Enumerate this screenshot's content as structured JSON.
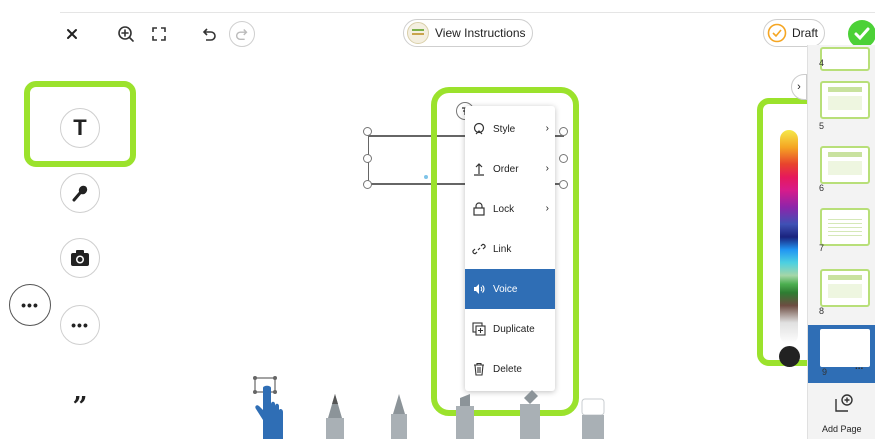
{
  "toolbar": {
    "view_instructions": "View Instructions",
    "draft": "Draft"
  },
  "context_menu": {
    "items": [
      {
        "label": "Style",
        "icon": "style-icon",
        "submenu": true
      },
      {
        "label": "Order",
        "icon": "order-icon",
        "submenu": true
      },
      {
        "label": "Lock",
        "icon": "lock-icon",
        "submenu": true
      },
      {
        "label": "Link",
        "icon": "link-icon",
        "submenu": false
      },
      {
        "label": "Voice",
        "icon": "speaker-icon",
        "submenu": false,
        "active": true
      },
      {
        "label": "Duplicate",
        "icon": "duplicate-icon",
        "submenu": false
      },
      {
        "label": "Delete",
        "icon": "trash-icon",
        "submenu": false
      }
    ]
  },
  "pages": {
    "numbers": [
      "4",
      "5",
      "6",
      "7",
      "8",
      "9"
    ],
    "add_page": "Add Page",
    "more": "..."
  },
  "colors": {
    "highlight_frame": "#9be22c",
    "active_menu": "#2f6eb5",
    "draft_badge": "#f5a623",
    "submit_check": "#4cd137",
    "tool_blue": "#2f6eb5"
  }
}
